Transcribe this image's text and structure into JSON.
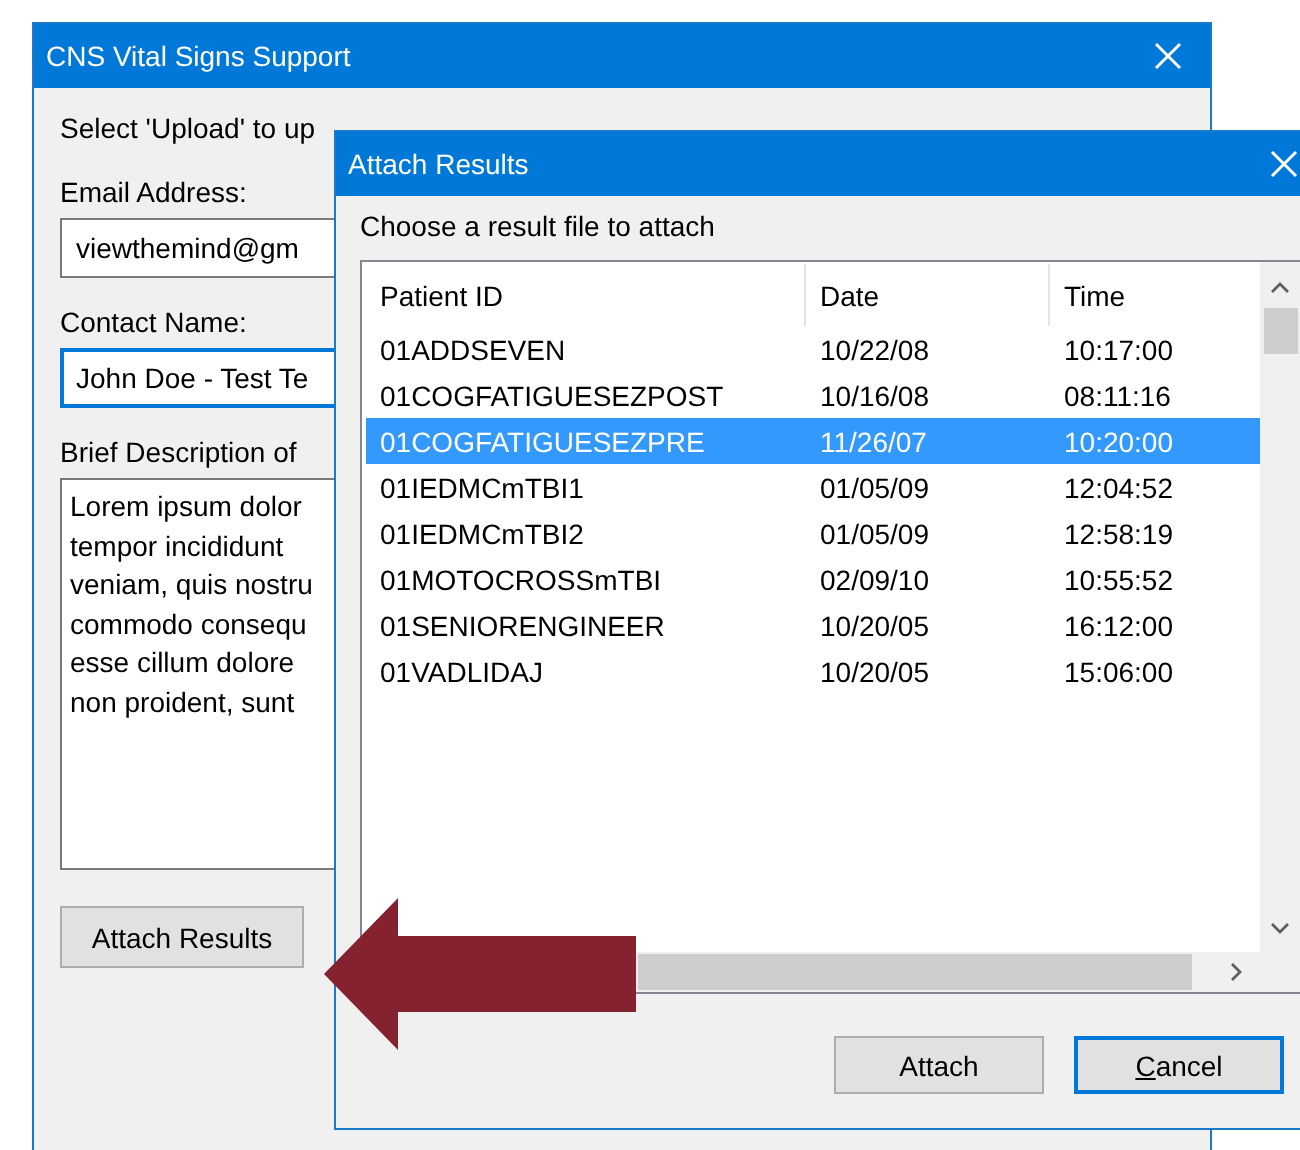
{
  "main_window": {
    "title": "CNS Vital Signs Support",
    "instruction": "Select 'Upload' to up",
    "email": {
      "label": "Email Address:",
      "value": "viewthemind@gm"
    },
    "contact": {
      "label": "Contact Name:",
      "value": "John Doe - Test Te"
    },
    "description": {
      "label": "Brief Description of",
      "lines": [
        "Lorem ipsum dolor",
        "tempor incididunt",
        "veniam, quis nostru",
        "commodo consequ",
        "esse cillum dolore",
        "non proident, sunt"
      ]
    },
    "attach_button": "Attach Results"
  },
  "dialog": {
    "title": "Attach Results",
    "prompt": "Choose a result file to attach",
    "columns": [
      "Patient ID",
      "Date",
      "Time"
    ],
    "rows": [
      {
        "cells": [
          "01ADDSEVEN",
          "10/22/08",
          "10:17:00"
        ],
        "selected": false
      },
      {
        "cells": [
          "01COGFATIGUESEZPOST",
          "10/16/08",
          "08:11:16"
        ],
        "selected": false
      },
      {
        "cells": [
          "01COGFATIGUESEZPRE",
          "11/26/07",
          "10:20:00"
        ],
        "selected": true
      },
      {
        "cells": [
          "01IEDMCmTBI1",
          "01/05/09",
          "12:04:52"
        ],
        "selected": false
      },
      {
        "cells": [
          "01IEDMCmTBI2",
          "01/05/09",
          "12:58:19"
        ],
        "selected": false
      },
      {
        "cells": [
          "01MOTOCROSSmTBI",
          "02/09/10",
          "10:55:52"
        ],
        "selected": false
      },
      {
        "cells": [
          "01SENIORENGINEER",
          "10/20/05",
          "16:12:00"
        ],
        "selected": false
      },
      {
        "cells": [
          "01VADLIDAJ",
          "10/20/05",
          "15:06:00"
        ],
        "selected": false
      }
    ],
    "buttons": [
      {
        "label": "Attach",
        "default": false,
        "underline_first": false
      },
      {
        "label": "Cancel",
        "default": true,
        "underline_first": true
      }
    ]
  }
}
